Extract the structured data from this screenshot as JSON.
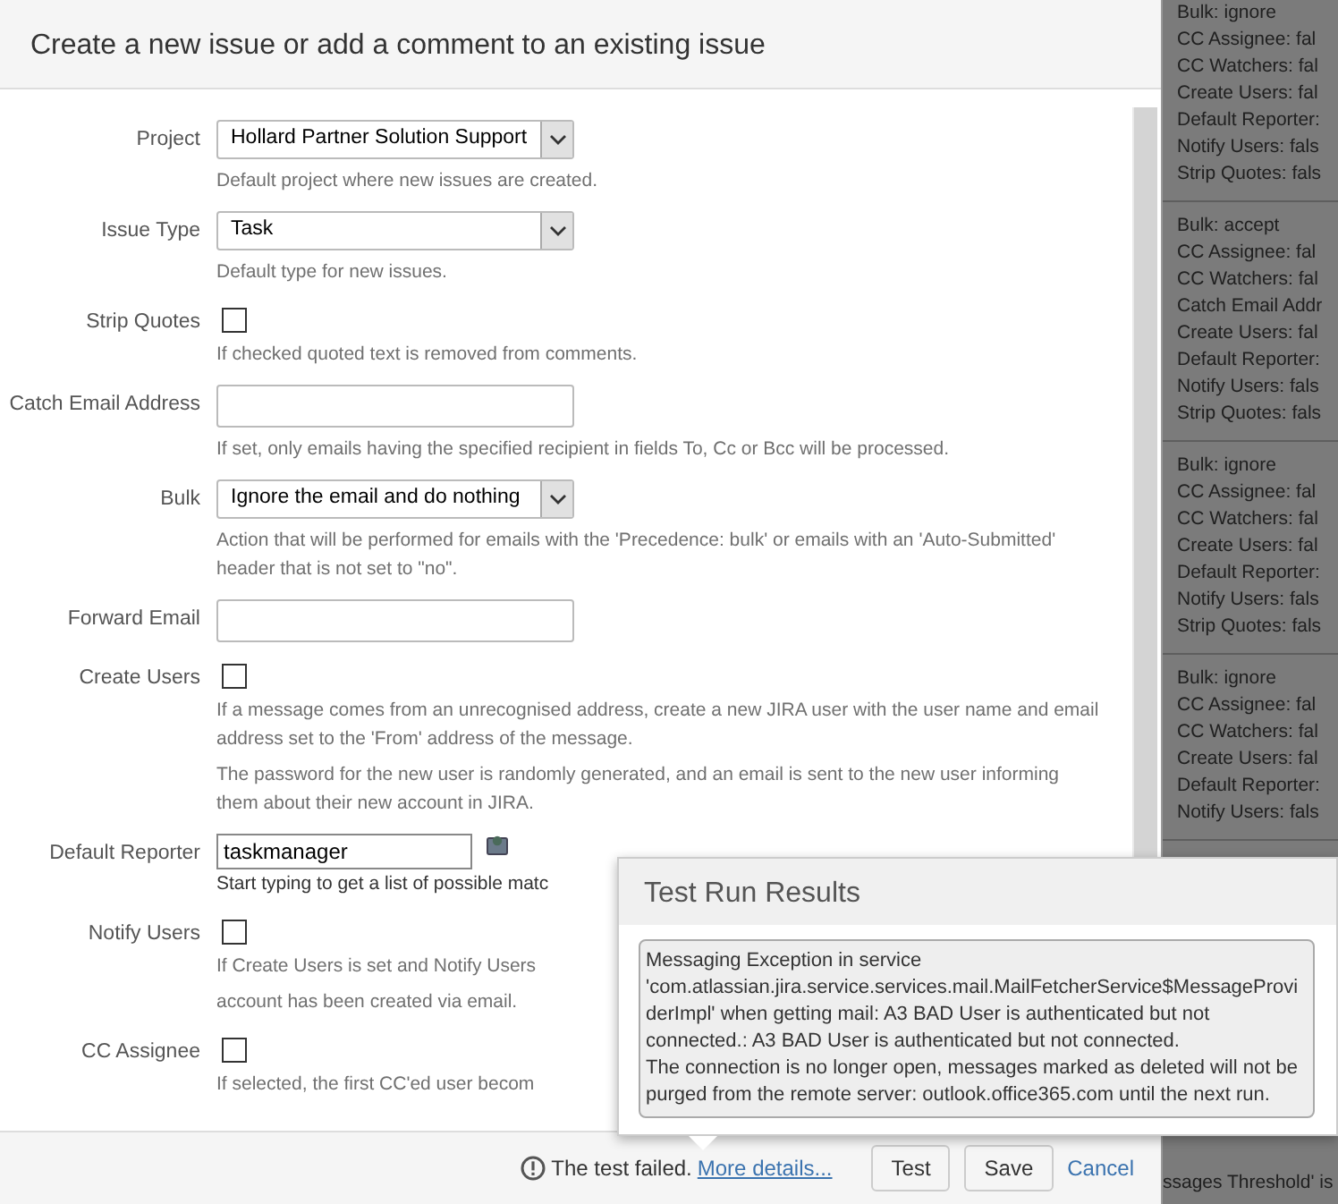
{
  "dialog": {
    "title": "Create a new issue or add a comment to an existing issue",
    "fields": [
      {
        "kind": "select",
        "label": "Project",
        "value": "Hollard Partner Solution Support",
        "help": [
          "Default project where new issues are created."
        ]
      },
      {
        "kind": "select",
        "label": "Issue Type",
        "value": "Task",
        "help": [
          "Default type for new issues."
        ]
      },
      {
        "kind": "checkbox",
        "label": "Strip Quotes",
        "checked": false,
        "help": [
          "If checked quoted text is removed from comments."
        ]
      },
      {
        "kind": "text",
        "label": "Catch Email Address",
        "help": [
          "If set, only emails having the specified recipient in fields To, Cc or Bcc will be processed."
        ]
      },
      {
        "kind": "select",
        "label": "Bulk",
        "value": "Ignore the email and do nothing",
        "help": [
          "Action that will be performed for emails with the 'Precedence: bulk' or emails with an 'Auto-Submitted' header that is not set to \"no\"."
        ]
      },
      {
        "kind": "text",
        "label": "Forward Email"
      },
      {
        "kind": "checkbox",
        "label": "Create Users",
        "checked": false,
        "help": [
          "If a message comes from an unrecognised address, create a new JIRA user with the user name and email address set to the 'From' address of the message.",
          "The password for the new user is randomly generated, and an email is sent to the new user informing them about their new account in JIRA."
        ]
      },
      {
        "kind": "user",
        "label": "Default Reporter",
        "value": "taskmanager",
        "help": [
          "Start typing to get a list of possible matc"
        ]
      },
      {
        "kind": "checkbox",
        "label": "Notify Users",
        "checked": false,
        "help": [
          "If Create Users is set and Notify Users",
          "account has been created via email."
        ]
      },
      {
        "kind": "checkbox",
        "label": "CC Assignee",
        "checked": false,
        "help": [
          "If selected, the first CC'ed user becom"
        ]
      }
    ],
    "footer": {
      "status": "The test failed.",
      "link": "More details...",
      "buttons": [
        {
          "kind": "button",
          "label": "Test"
        },
        {
          "kind": "button",
          "label": "Save"
        },
        {
          "kind": "link",
          "label": "Cancel"
        }
      ]
    }
  },
  "popup": {
    "title": "Test Run Results",
    "message": [
      "Messaging Exception in service 'com.atlassian.jira.service.services.mail.MailFetcherService$MessageProviderImpl' when getting mail: A3 BAD User is authenticated but not connected.: A3 BAD User is authenticated but not connected.",
      "The connection is no longer open, messages marked as deleted will not be purged from the remote server: outlook.office365.com until the next run."
    ]
  },
  "background": {
    "groups": [
      [
        "Bulk: ignore",
        "CC Assignee: fal",
        "CC Watchers: fal",
        "Create Users: fal",
        "Default Reporter:",
        "Notify Users: fals",
        "Strip Quotes: fals"
      ],
      [
        "Bulk: accept",
        "CC Assignee: fal",
        "CC Watchers: fal",
        "Catch Email Addr",
        "Create Users: fal",
        "Default Reporter:",
        "Notify Users: fals",
        "Strip Quotes: fals"
      ],
      [
        "Bulk: ignore",
        "CC Assignee: fal",
        "CC Watchers: fal",
        "Create Users: fal",
        "Default Reporter:",
        "Notify Users: fals",
        "Strip Quotes: fals"
      ],
      [
        "Bulk: ignore",
        "CC Assignee: fal",
        "CC Watchers: fal",
        "Create Users: fal",
        "Default Reporter:",
        "Notify Users: fals"
      ]
    ],
    "bottom_text": "ssages Threshold' is"
  }
}
